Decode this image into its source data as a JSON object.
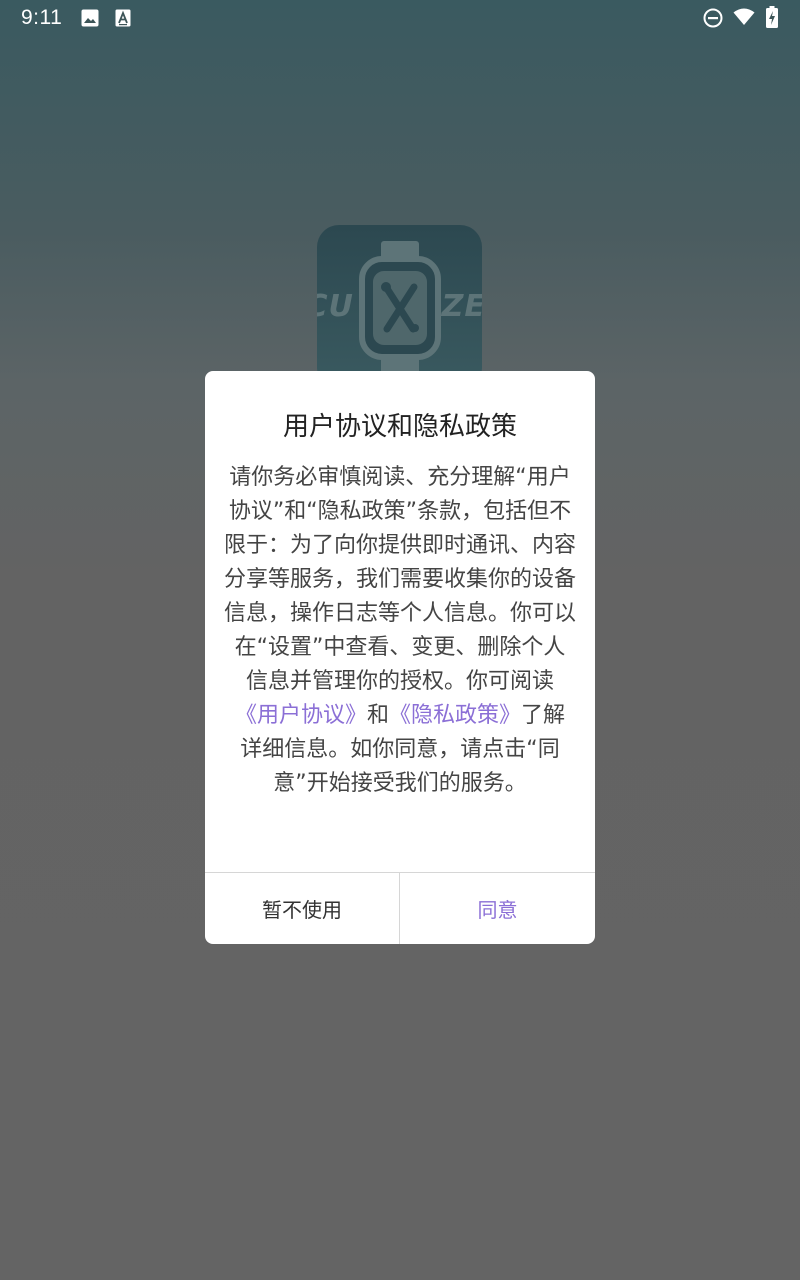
{
  "status_bar": {
    "time": "9:11",
    "left_icons": [
      "image-icon",
      "text-a-icon"
    ],
    "right_icons": [
      "do-not-disturb-icon",
      "wifi-icon",
      "battery-charging-icon"
    ]
  },
  "app_icon": {
    "icon": "smartwatch-tools-icon",
    "text_fragment_left": "CU",
    "text_fragment_right": "IZE"
  },
  "dialog": {
    "title": "用户协议和隐私政策",
    "body_part1": "请你务必审慎阅读、充分理解“用户协议”和“隐私政策”条款，包括但不限于：为了向你提供即时通讯、内容分享等服务，我们需要收集你的设备信息，操作日志等个人信息。你可以在“设置”中查看、变更、删除个人信息并管理你的授权。你可阅读",
    "link_user_agreement": "《用户协议》",
    "body_and": "和",
    "link_privacy_policy": "《隐私政策》",
    "body_part2": "了解详细信息。如你同意，请点击“同意”开始接受我们的服务。",
    "decline_label": "暂不使用",
    "agree_label": "同意"
  },
  "colors": {
    "accent": "#8b6fd6",
    "overlay": "#646464",
    "dialog_bg": "#ffffff"
  }
}
